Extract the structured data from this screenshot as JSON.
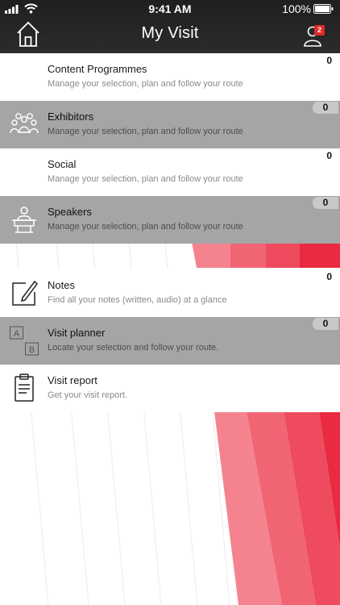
{
  "status": {
    "time": "9:41 AM",
    "battery": "100%"
  },
  "header": {
    "title": "My Visit",
    "notification_count": "2"
  },
  "items": [
    {
      "label": "Content Programmes",
      "desc": "Manage your selection, plan and follow your route",
      "count": "0",
      "icon": "none"
    },
    {
      "label": "Exhibitors",
      "desc": "Manage your selection, plan and follow your route",
      "count": "0",
      "icon": "people-group-icon"
    },
    {
      "label": "Social",
      "desc": "Manage your selection, plan and follow your route",
      "count": "0",
      "icon": "none"
    },
    {
      "label": "Speakers",
      "desc": "Manage your selection, plan and follow your route",
      "count": "0",
      "icon": "speaker-podium-icon"
    },
    {
      "label": "Notes",
      "desc": "Find all your notes (written, audio) at a glance",
      "count": "0",
      "icon": "note-pencil-icon"
    },
    {
      "label": "Visit planner",
      "desc": "Locate your selection and follow your route.",
      "count": "0",
      "icon": "ab-route-icon"
    },
    {
      "label": "Visit report",
      "desc": "Get your visit report.",
      "count": "",
      "icon": "clipboard-icon"
    }
  ],
  "colors": {
    "header": "#262626",
    "row_grey": "#a5a5a5",
    "accent_red": "#e8283c",
    "badge": "#e02b2b"
  }
}
